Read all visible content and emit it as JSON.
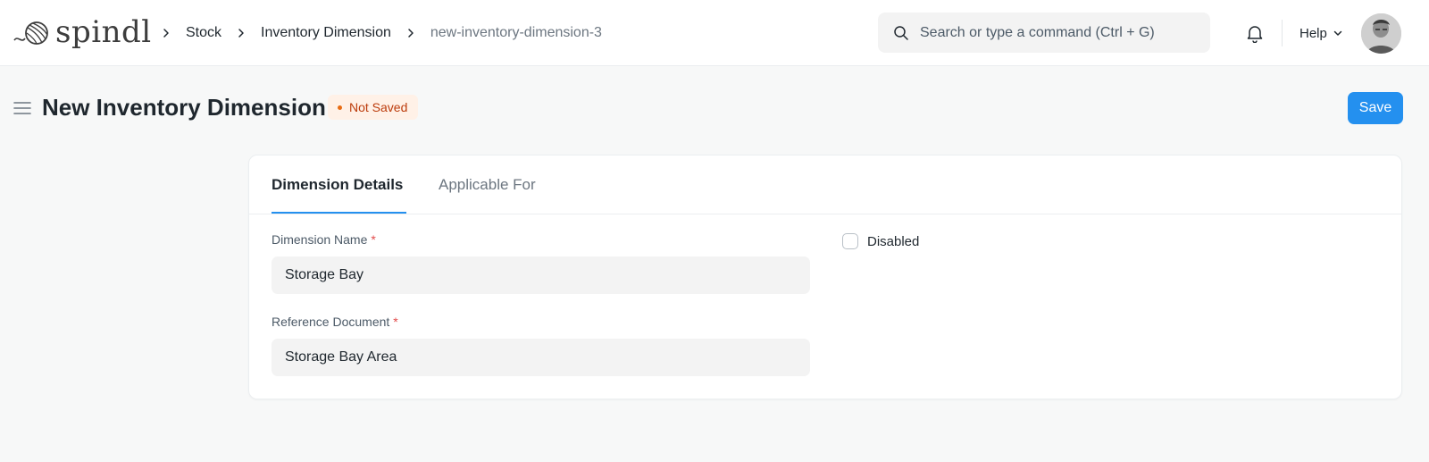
{
  "app": {
    "logo_text": "spindl"
  },
  "breadcrumbs": [
    {
      "label": "Stock"
    },
    {
      "label": "Inventory Dimension"
    },
    {
      "label": "new-inventory-dimension-3"
    }
  ],
  "search": {
    "placeholder": "Search or type a command (Ctrl + G)",
    "value": ""
  },
  "navbar": {
    "help_label": "Help",
    "icons": [
      "search-icon",
      "bell-icon",
      "chevron-down-icon"
    ]
  },
  "page": {
    "title": "New Inventory Dimension",
    "status": "Not Saved",
    "save_label": "Save"
  },
  "tabs": [
    {
      "label": "Dimension Details",
      "active": true
    },
    {
      "label": "Applicable For",
      "active": false
    }
  ],
  "form": {
    "dimension_name": {
      "label": "Dimension Name",
      "required_marker": "*",
      "value": "Storage Bay"
    },
    "reference_document": {
      "label": "Reference Document",
      "required_marker": "*",
      "value": "Storage Bay Area"
    },
    "disabled": {
      "label": "Disabled",
      "checked": false
    }
  },
  "colors": {
    "primary": "#2490ef",
    "badge_bg": "#fff1e7",
    "badge_text": "#bc3c0c",
    "required": "#e24c4c"
  }
}
